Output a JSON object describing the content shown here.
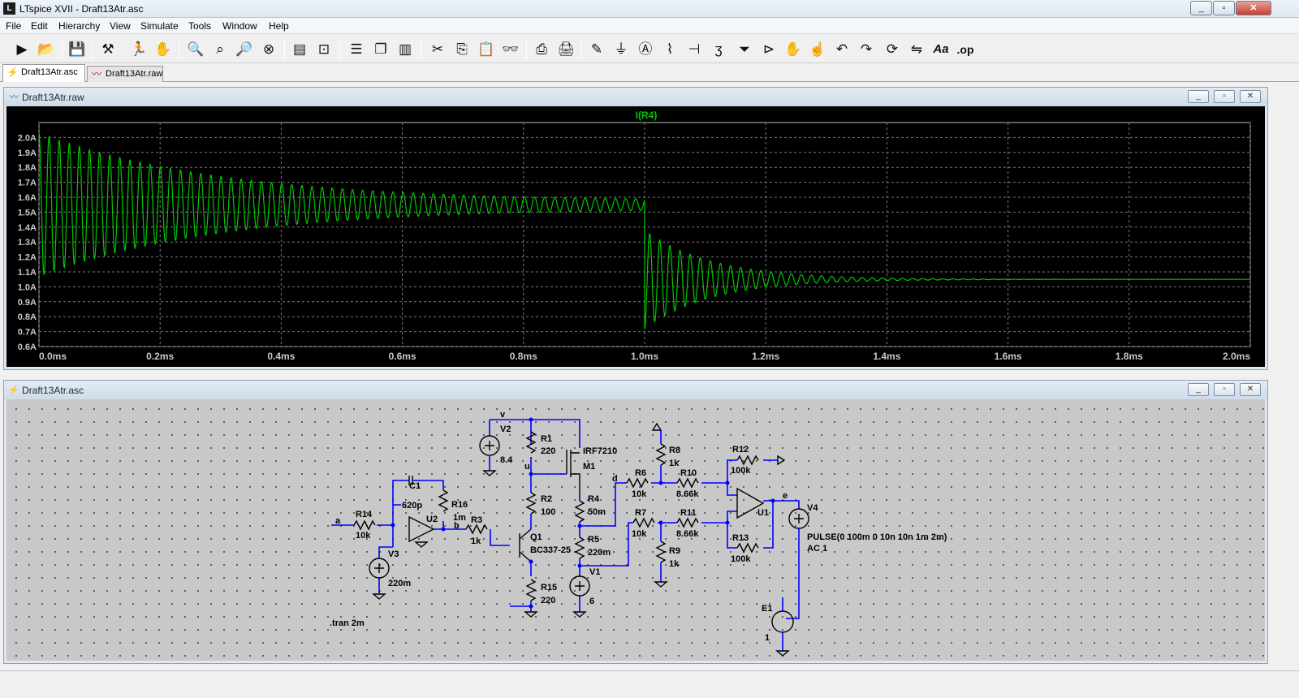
{
  "window": {
    "title": "LTspice XVII - Draft13Atr.asc",
    "app_icon": "ltspice-icon"
  },
  "menu": [
    "File",
    "Edit",
    "Hierarchy",
    "View",
    "Simulate",
    "Tools",
    "Window",
    "Help"
  ],
  "toolbar": {
    "icons": [
      "run-icon",
      "open-icon",
      "save-icon",
      "control-panel-icon",
      "run-man-icon",
      "pan-hand-icon",
      "zoom-in-icon",
      "zoom-area-icon",
      "zoom-out-icon",
      "zoom-cancel-icon",
      "autorange-icon",
      "fit-icon",
      "tile-horizontal-icon",
      "cascade-icon",
      "tile-vertical-icon",
      "cut-icon",
      "copy-icon",
      "paste-icon",
      "find-icon",
      "print-setup-icon",
      "print-icon",
      "draw-wire-icon",
      "ground-icon",
      "label-net-icon",
      "resistor-icon",
      "capacitor-icon",
      "inductor-icon",
      "diode-icon",
      "component-icon",
      "move-hand-icon",
      "drag-hand-icon",
      "undo-icon",
      "redo-icon",
      "rotate-icon",
      "mirror-icon",
      "text-icon",
      "spice-directive-icon"
    ],
    "text_buttons": {
      "text": "Aa",
      "spice": ".op"
    }
  },
  "doc_tabs": [
    {
      "label": "Draft13Atr.asc",
      "icon": "schematic-icon",
      "active": true
    },
    {
      "label": "Draft13Atr.raw",
      "icon": "waveform-icon",
      "active": false
    }
  ],
  "plot_window": {
    "title": "Draft13Atr.raw",
    "trace_label": "I(R4)",
    "trace_color": "#00c800",
    "background": "#000000"
  },
  "chart_data": {
    "type": "line",
    "title": "I(R4)",
    "xlabel": "",
    "ylabel": "",
    "x_ticks": [
      "0.0ms",
      "0.2ms",
      "0.4ms",
      "0.6ms",
      "0.8ms",
      "1.0ms",
      "1.2ms",
      "1.4ms",
      "1.6ms",
      "1.8ms",
      "2.0ms"
    ],
    "y_ticks": [
      "2.0A",
      "1.9A",
      "1.8A",
      "1.7A",
      "1.6A",
      "1.5A",
      "1.4A",
      "1.3A",
      "1.2A",
      "1.1A",
      "1.0A",
      "0.9A",
      "0.8A",
      "0.7A",
      "0.6A"
    ],
    "xlim_ms": [
      0,
      2.0
    ],
    "ylim_A": [
      0.6,
      2.1
    ],
    "grid": true,
    "series": [
      {
        "name": "I(R4)",
        "segments": [
          {
            "t_start_ms": 0.0,
            "t_end_ms": 1.0,
            "center_start_A": 1.55,
            "center_end_A": 1.55,
            "amp_start_A": 0.48,
            "amp_end_A": 0.02,
            "period_ms": 0.0167
          },
          {
            "t_start_ms": 1.0,
            "t_end_ms": 2.0,
            "center_start_A": 1.05,
            "center_end_A": 1.05,
            "amp_start_A": 0.33,
            "amp_end_A": 0.0,
            "period_ms": 0.0167
          }
        ]
      }
    ]
  },
  "schematic_window": {
    "title": "Draft13Atr.asc",
    "labels": {
      "V2": "V2",
      "V2_val": "8.4",
      "v_net": "v",
      "R1": "R1",
      "R1_val": "220",
      "M1_model": "IRF7210",
      "M1": "M1",
      "u_net": "u",
      "R2": "R2",
      "R2_val": "100",
      "R4": "R4",
      "R4_val": "50m",
      "R5": "R5",
      "R5_val": "220m",
      "Q1": "Q1",
      "Q1_model": "BC337-25",
      "R15": "R15",
      "R15_val": "220",
      "V1": "V1",
      "V1_val": "6",
      "C1": "C1",
      "C1_val": "620p",
      "R16": "R16",
      "R16_val": "1m",
      "U2": "U2",
      "a_net": "a",
      "b_net": "b",
      "R14": "R14",
      "R14_val": "10k",
      "R3": "R3",
      "R3_val": "1k",
      "V3": "V3",
      "V3_val": "220m",
      "R8": "R8",
      "R8_val": "1k",
      "d_net": "d",
      "R6": "R6",
      "R6_val": "10k",
      "R10": "R10",
      "R10_val": "8.66k",
      "R7": "R7",
      "R7_val": "10k",
      "R11": "R11",
      "R11_val": "8.66k",
      "R9": "R9",
      "R9_val": "1k",
      "R12": "R12",
      "R12_val": "100k",
      "R13": "R13",
      "R13_val": "100k",
      "U1": "U1",
      "e_net": "e",
      "V4": "V4",
      "V4_pulse": "PULSE(0 100m 0 10n 10n 1m 2m)",
      "V4_ac": "AC 1",
      "E1": "E1",
      "E1_val": "1",
      "directive": ".tran 2m"
    }
  }
}
